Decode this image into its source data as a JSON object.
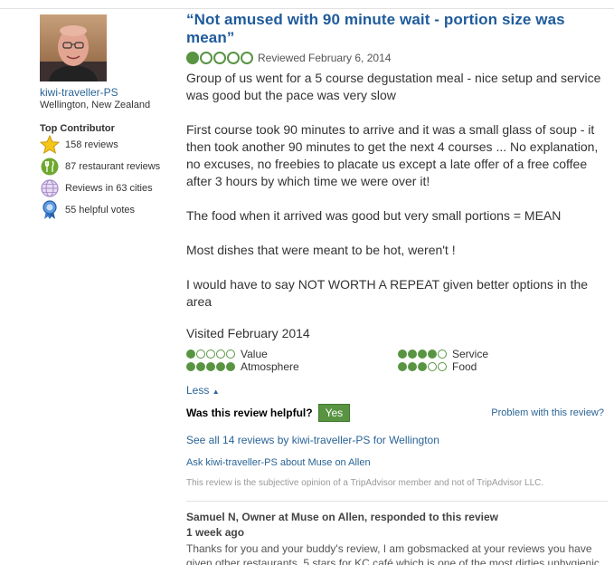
{
  "member": {
    "username": "kiwi-traveller-PS",
    "location": "Wellington, New Zealand",
    "badge_title": "Top Contributor",
    "badges": [
      {
        "icon": "star-icon",
        "text": "158 reviews"
      },
      {
        "icon": "fork-knife-icon",
        "text": "87 restaurant reviews"
      },
      {
        "icon": "globe-icon",
        "text": "Reviews in 63 cities"
      },
      {
        "icon": "helpful-ribbon-icon",
        "text": "55 helpful votes"
      }
    ]
  },
  "review": {
    "title": "“Not amused with 90 minute wait - portion size was mean”",
    "rating": 1,
    "rating_max": 5,
    "reviewed_date": "Reviewed February 6, 2014",
    "paragraphs": [
      "Group of us went for a 5 course degustation meal - nice setup and service was good but the pace was very slow",
      "First course took 90 minutes to arrive and it was a small glass of soup - it then took another 90 minutes to get the next 4 courses ... No explanation, no excuses, no freebies to placate us except a late offer of a free coffee after 3 hours by which time we were over it!",
      "The food when it arrived was good but very small portions = MEAN",
      "Most dishes that were meant to be hot, weren't !",
      "I would have to say NOT WORTH A REPEAT given better options in the area"
    ],
    "visited": "Visited February 2014",
    "subratings": [
      {
        "label": "Value",
        "rating": 1
      },
      {
        "label": "Service",
        "rating": 4
      },
      {
        "label": "Atmosphere",
        "rating": 5
      },
      {
        "label": "Food",
        "rating": 3
      }
    ],
    "less_link": "Less",
    "helpful_question": "Was this review helpful?",
    "yes_button": "Yes",
    "problem_link": "Problem with this review?",
    "see_all_link": "See all 14 reviews by kiwi-traveller-PS for Wellington",
    "ask_link": "Ask kiwi-traveller-PS about Muse on Allen",
    "disclaimer": "This review is the subjective opinion of a TripAdvisor member and not of TripAdvisor LLC."
  },
  "response": {
    "title": "Samuel N, Owner at Muse on Allen, responded to this review",
    "date": "1 week ago",
    "body": "Thanks for you and your buddy's review, I am gobsmacked at your reviews you have given other restaurants, 5 stars for KC café which is one of the most dirties unhygienic"
  },
  "colors": {
    "link": "#2a6496",
    "title": "#1f5b9c",
    "bubble_green": "#589442"
  }
}
